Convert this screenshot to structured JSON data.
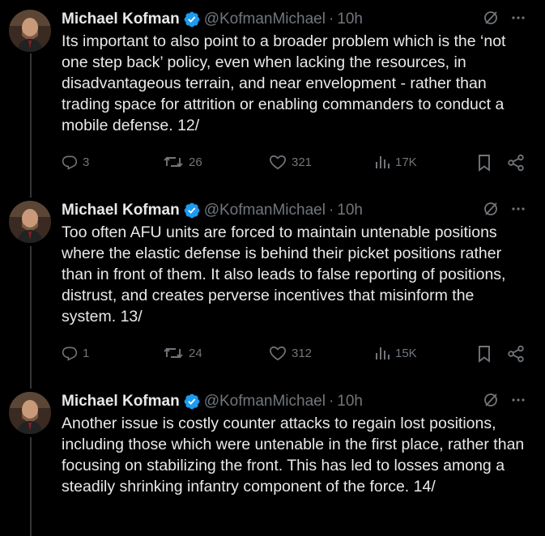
{
  "tweets": [
    {
      "author_name": "Michael Kofman",
      "handle": "@KofmanMichael",
      "separator": "·",
      "time": "10h",
      "text": "Its important to also point to a broader problem which is the ‘not one step back’ policy, even when lacking the resources, in disadvantageous terrain, and near envelopment - rather than trading space for attrition or enabling commanders to conduct a mobile defense. 12/",
      "replies": "3",
      "reposts": "26",
      "likes": "321",
      "views": "17K"
    },
    {
      "author_name": "Michael Kofman",
      "handle": "@KofmanMichael",
      "separator": "·",
      "time": "10h",
      "text": "Too often AFU units are forced to maintain untenable positions where the elastic defense is behind their picket positions rather than in front of them. It also leads to false reporting of positions, distrust, and creates perverse incentives that misinform the system. 13/",
      "replies": "1",
      "reposts": "24",
      "likes": "312",
      "views": "15K"
    },
    {
      "author_name": "Michael Kofman",
      "handle": "@KofmanMichael",
      "separator": "·",
      "time": "10h",
      "text": "Another issue is costly counter attacks to regain lost positions, including those which were untenable in the first place, rather than focusing on stabilizing the front. This has led to losses among a steadily shrinking infantry component of the force. 14/"
    }
  ],
  "icons": {
    "verified": "verified-badge-icon",
    "grok": "grok-icon",
    "more": "more-icon",
    "reply": "reply-icon",
    "repost": "repost-icon",
    "like": "like-icon",
    "views": "views-icon",
    "bookmark": "bookmark-icon",
    "share": "share-icon"
  },
  "colors": {
    "background": "#000000",
    "text": "#e7e9ea",
    "muted": "#71767b",
    "verified": "#1d9bf0",
    "thread_line": "#333639"
  }
}
